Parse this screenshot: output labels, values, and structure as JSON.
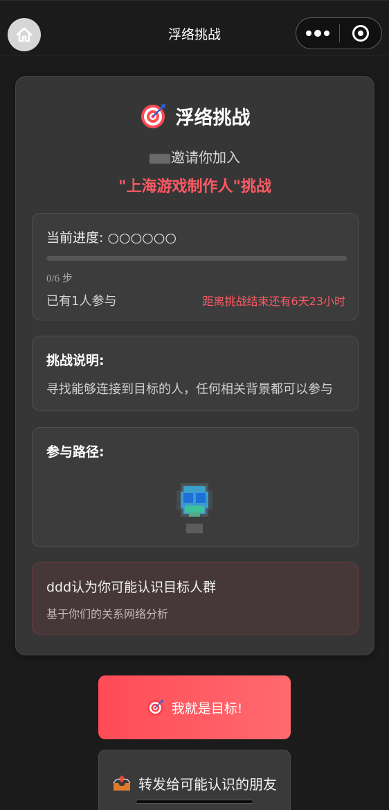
{
  "nav": {
    "title": "浮络挑战"
  },
  "card": {
    "title": "浮络挑战",
    "invite_suffix": "邀请你加入",
    "challenge_name": "\"上海游戏制作人\"挑战"
  },
  "progress": {
    "label": "当前进度: ○○○○○○",
    "fraction": 0,
    "steps_text": "0/6 步",
    "participants": "已有1人参与",
    "countdown": "距离挑战结束还有6天23小时"
  },
  "description": {
    "heading": "挑战说明:",
    "text": "寻找能够连接到目标的人，任何相关背景都可以参与"
  },
  "path": {
    "heading": "参与路径:"
  },
  "hint": {
    "title": "ddd认为你可能认识目标人群",
    "subtitle": "基于你们的关系网络分析"
  },
  "buttons": {
    "primary_label": "我就是目标!",
    "primary_icon": "target-icon",
    "secondary_label": "转发给可能认识的朋友",
    "secondary_icon": "outbox-tray-icon"
  },
  "colors": {
    "accent": "#ff5a64",
    "background": "#1b1b1b",
    "card": "#363636"
  }
}
